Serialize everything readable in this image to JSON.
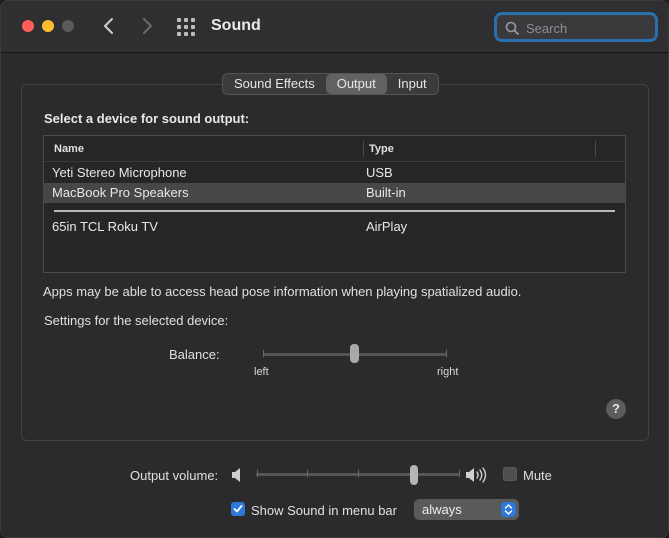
{
  "window": {
    "title": "Sound"
  },
  "search": {
    "placeholder": "Search"
  },
  "tabs": [
    {
      "label": "Sound Effects",
      "active": false
    },
    {
      "label": "Output",
      "active": true
    },
    {
      "label": "Input",
      "active": false
    }
  ],
  "output": {
    "select_label": "Select a device for sound output:",
    "columns": [
      "Name",
      "Type"
    ],
    "devices": [
      {
        "name": "Yeti Stereo Microphone",
        "type": "USB",
        "selected": false
      },
      {
        "name": "MacBook Pro Speakers",
        "type": "Built-in",
        "selected": true
      },
      {
        "name": "65in TCL Roku TV",
        "type": "AirPlay",
        "selected": false
      }
    ],
    "info_text": "Apps may be able to access head pose information when playing spatialized audio.",
    "settings_label": "Settings for the selected device:",
    "balance": {
      "label": "Balance:",
      "left_label": "left",
      "right_label": "right",
      "value": 0.5
    },
    "help_glyph": "?"
  },
  "volume": {
    "label": "Output volume:",
    "value": 0.75,
    "mute_label": "Mute",
    "muted": false
  },
  "menubar": {
    "label": "Show Sound in menu bar",
    "checked": true,
    "popup_value": "always"
  },
  "colors": {
    "accent": "#2d78d9",
    "close": "#ff5f57",
    "minimize": "#febc2e",
    "search_focus": "#2a6fae"
  }
}
